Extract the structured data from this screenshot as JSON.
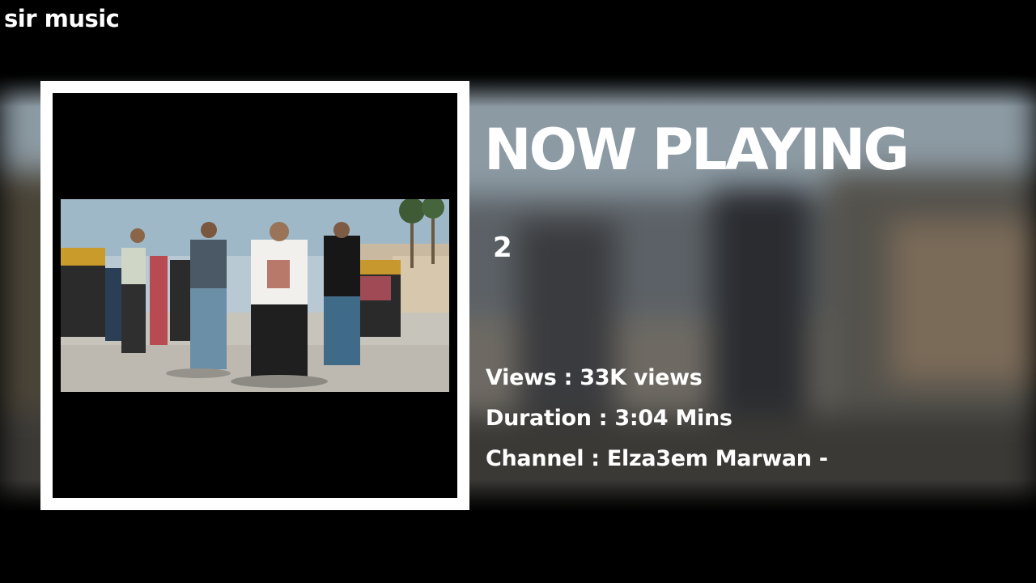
{
  "app": {
    "brand": "sir music"
  },
  "player": {
    "heading": "NOW PLAYING",
    "track_title": "2",
    "views_label": "Views : ",
    "views_value": "33K views",
    "duration_label": "Duration : ",
    "duration_value": "3:04 Mins",
    "channel_label": "Channel : ",
    "channel_value": "Elza3em Marwan -"
  },
  "colors": {
    "background": "#000000",
    "text": "#ffffff",
    "frame": "#ffffff"
  }
}
